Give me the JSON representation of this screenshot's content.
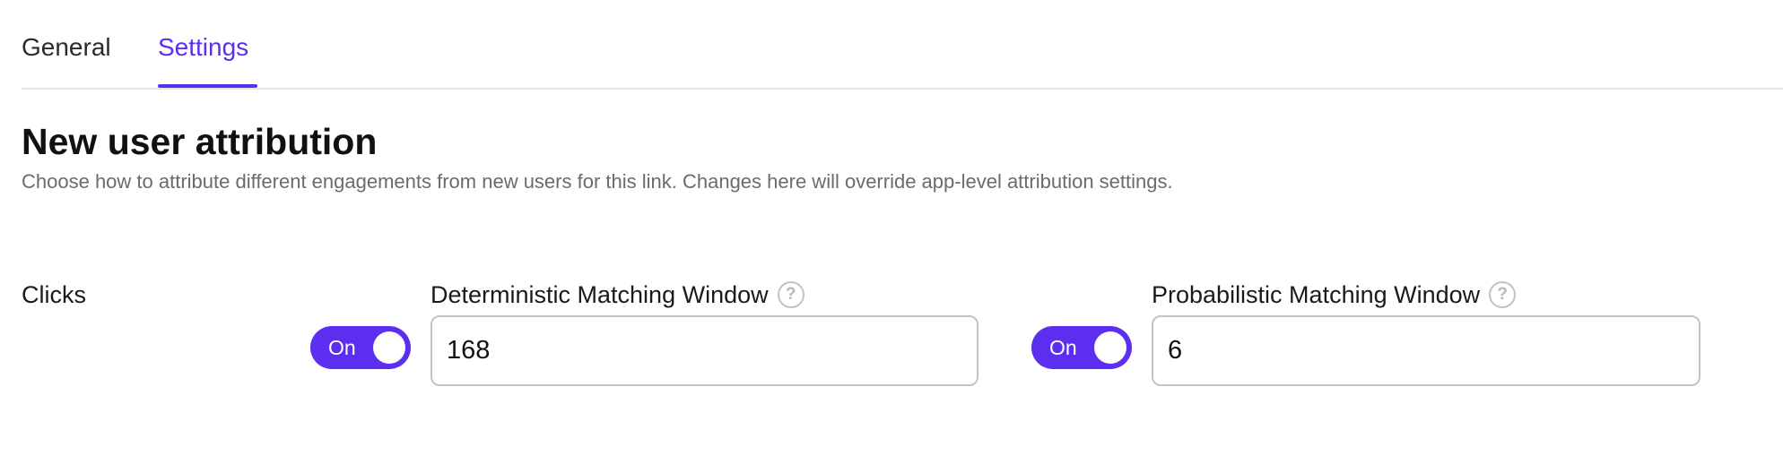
{
  "tabs": [
    {
      "label": "General",
      "active": false
    },
    {
      "label": "Settings",
      "active": true
    }
  ],
  "accent_color": "#5b2ef0",
  "section": {
    "title": "New user attribution",
    "description": "Choose how to attribute different engagements from new users for this link. Changes here will override app-level attribution settings."
  },
  "clicks": {
    "label": "Clicks",
    "deterministic": {
      "label": "Deterministic Matching Window",
      "help_icon": "?",
      "toggle_label": "On",
      "toggle_state": true,
      "value": "168"
    },
    "probabilistic": {
      "label": "Probabilistic Matching Window",
      "help_icon": "?",
      "toggle_label": "On",
      "toggle_state": true,
      "value": "6"
    }
  }
}
